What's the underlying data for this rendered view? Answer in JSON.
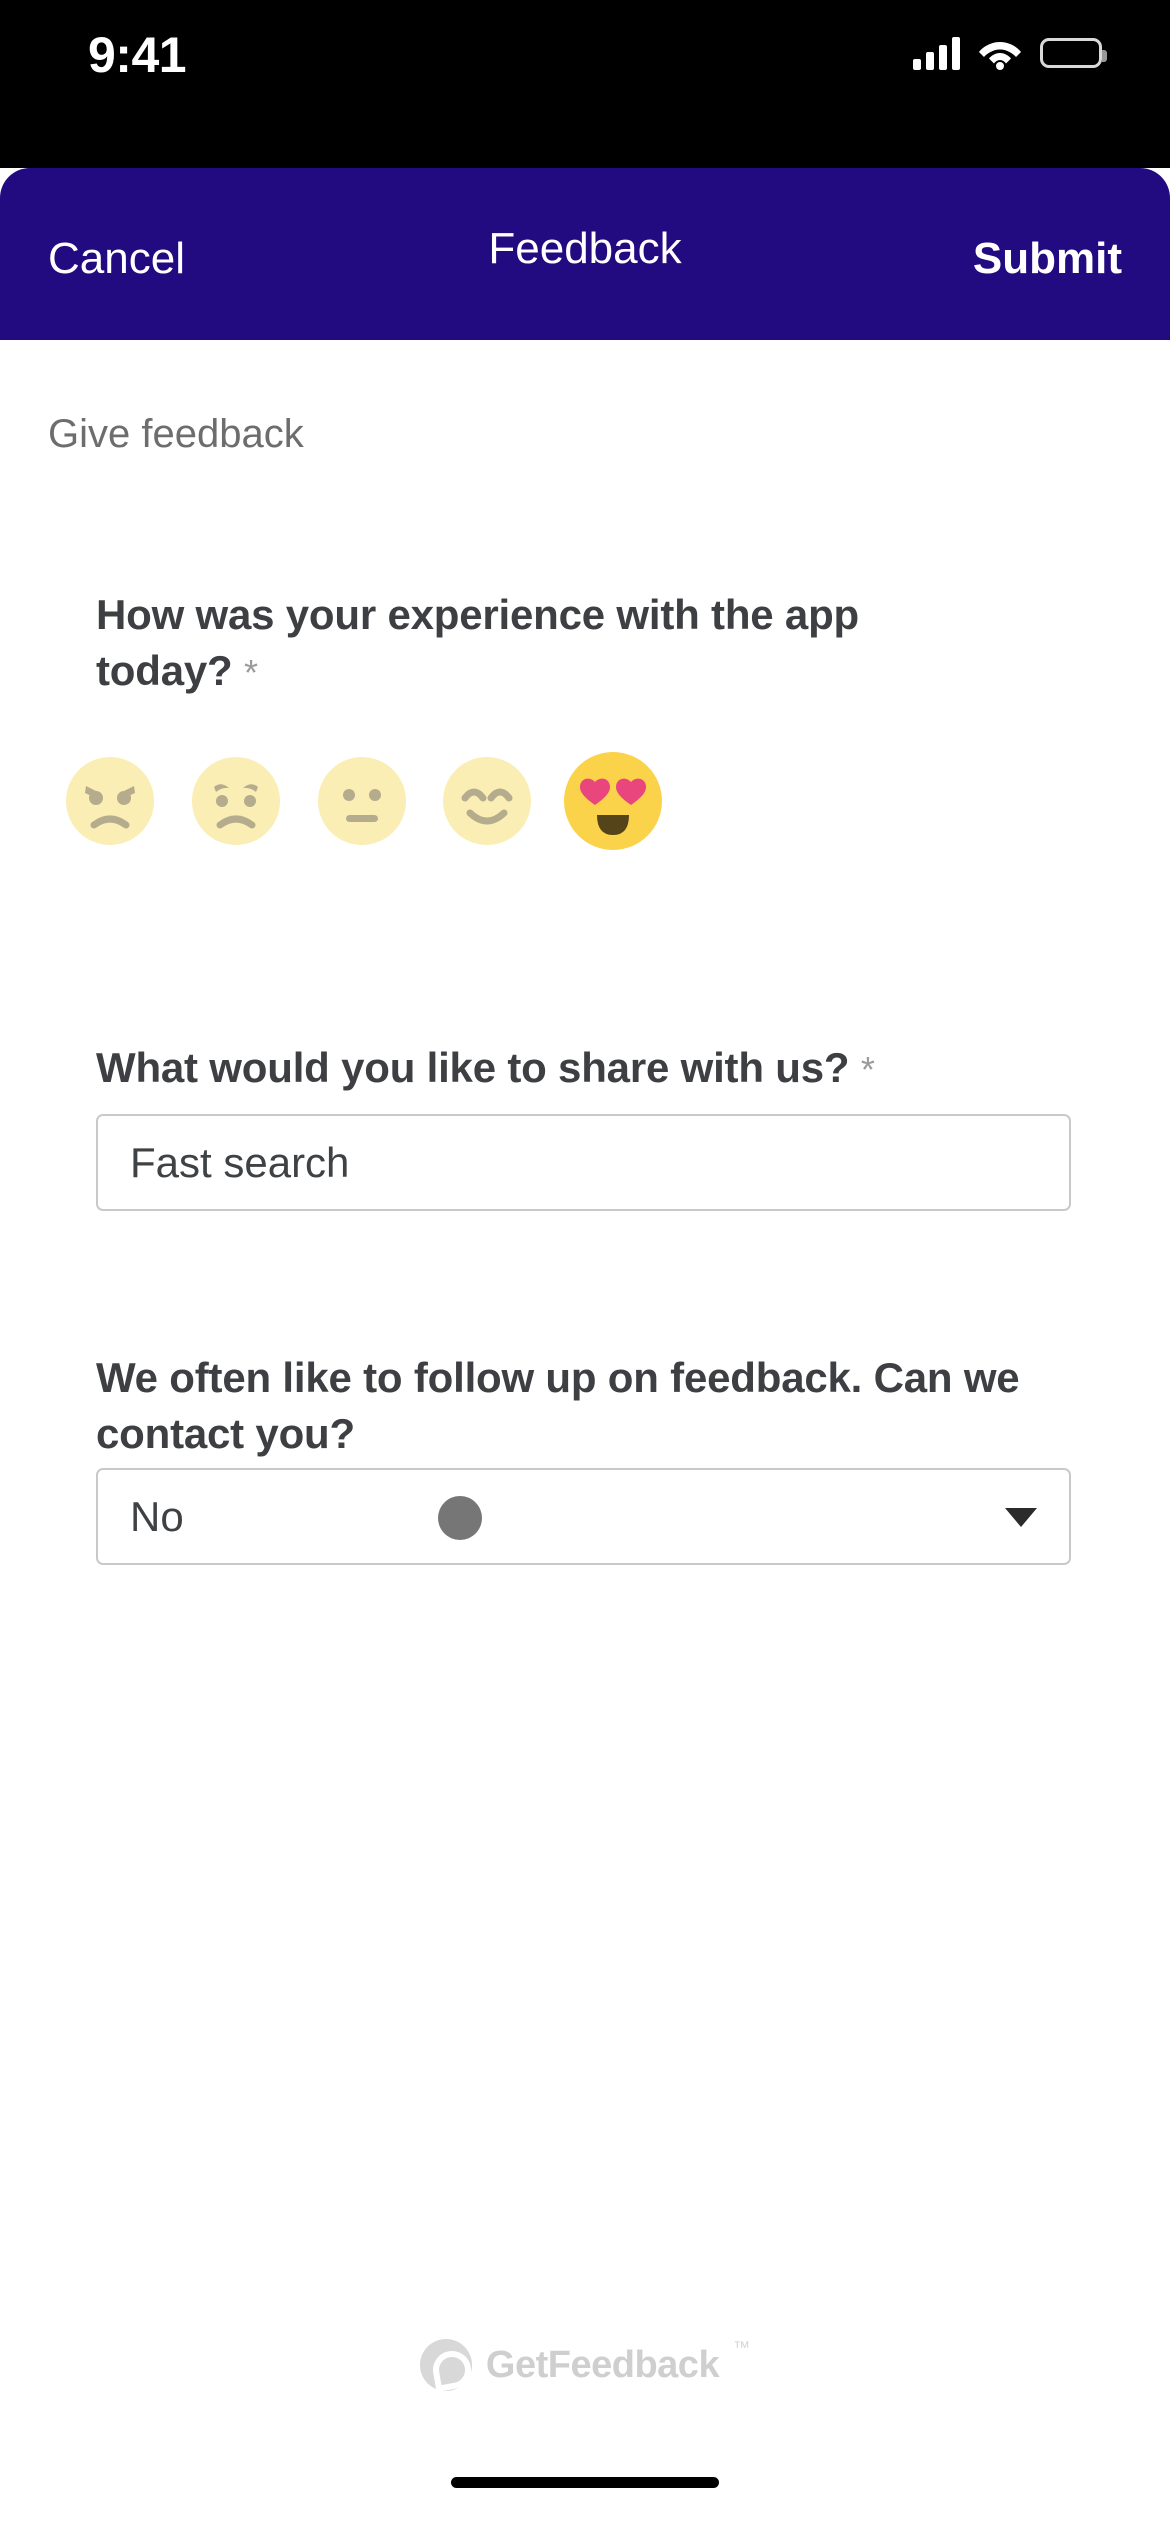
{
  "status_bar": {
    "time": "9:41",
    "cellular_icon": "cellular-bars-icon",
    "wifi_icon": "wifi-icon",
    "battery_icon": "battery-full-icon"
  },
  "nav": {
    "cancel_label": "Cancel",
    "title": "Feedback",
    "submit_label": "Submit",
    "background_color": "#220A80",
    "text_color": "#FFFFFF"
  },
  "page": {
    "eyebrow": "Give feedback"
  },
  "questions": [
    {
      "id": "experience",
      "text": "How was your experience with the app today?",
      "required_marker": "*",
      "type": "emoji-scale",
      "selected_index": 4,
      "options": [
        {
          "label": "angry-face",
          "value": 1,
          "selected": false
        },
        {
          "label": "sad-face",
          "value": 2,
          "selected": false
        },
        {
          "label": "neutral-face",
          "value": 3,
          "selected": false
        },
        {
          "label": "smiling-face",
          "value": 4,
          "selected": false
        },
        {
          "label": "heart-eyes-face",
          "value": 5,
          "selected": true
        }
      ],
      "unselected_color": "#FAEEB4",
      "selected_color": "#FBD34B",
      "feature_color": "#B5AC8E",
      "heart_color": "#E8467C",
      "mouth_color": "#55431A"
    },
    {
      "id": "share",
      "text": "What would you like to share with us?",
      "required_marker": "*",
      "type": "text",
      "value": "Fast search",
      "placeholder": ""
    },
    {
      "id": "contact",
      "text": "We often like to follow up on feedback. Can we contact you?",
      "required_marker": "",
      "type": "select",
      "value": "No",
      "chevron_icon": "chevron-down-icon",
      "knob_icon": "slider-knob-icon"
    }
  ],
  "footer": {
    "brand_mark": "getfeedback-logo-icon",
    "brand_name": "GetFeedback",
    "trademark": "™"
  }
}
